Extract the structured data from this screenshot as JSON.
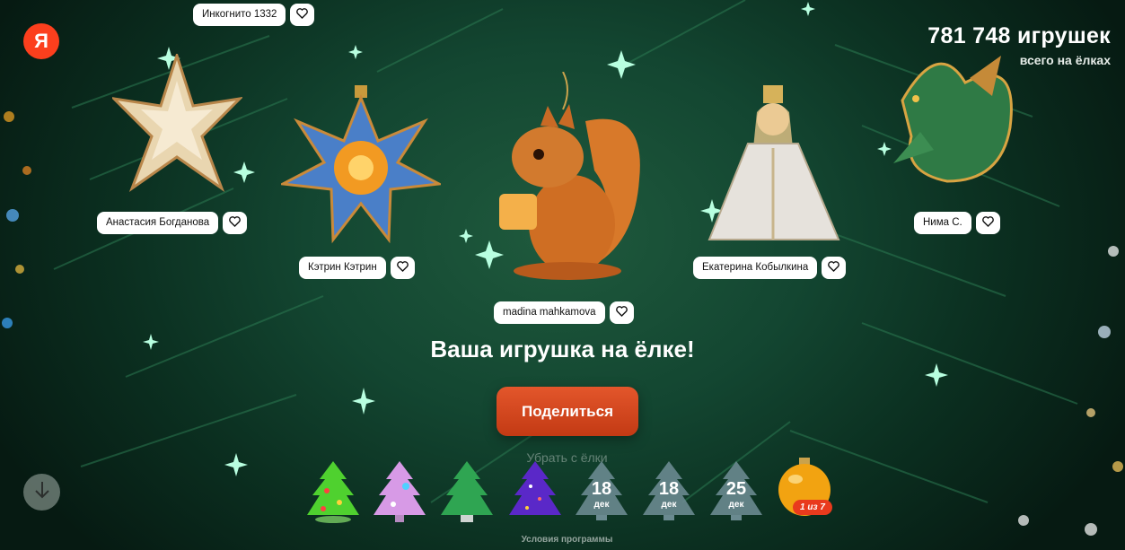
{
  "header": {
    "logo": "Я",
    "counter_value": "781 748 игрушек",
    "counter_caption": "всего на ёлках"
  },
  "ornaments": [
    {
      "name": "Инкогнито 1332",
      "icon": "heart-icon"
    },
    {
      "name": "Анастасия Богданова",
      "icon": "heart-icon"
    },
    {
      "name": "Кэтрин Кэтрин",
      "icon": "heart-icon"
    },
    {
      "name": "madina mahkamova",
      "icon": "heart-icon"
    },
    {
      "name": "Екатерина Кобылкина",
      "icon": "heart-icon"
    },
    {
      "name": "Нима С.",
      "icon": "heart-icon"
    }
  ],
  "main": {
    "headline": "Ваша игрушка на ёлке!",
    "share_label": "Поделиться",
    "remove_label": "Убрать с ёлки",
    "terms_label": "Условия программы"
  },
  "calendar": {
    "locked": [
      {
        "day": "18",
        "month": "дек"
      },
      {
        "day": "18",
        "month": "дек"
      },
      {
        "day": "25",
        "month": "дек"
      }
    ],
    "progress_badge": "1 из 7"
  },
  "colors": {
    "brand": "#fc3f1d",
    "share_button": "#d9481f",
    "tree_background": "#134631"
  }
}
